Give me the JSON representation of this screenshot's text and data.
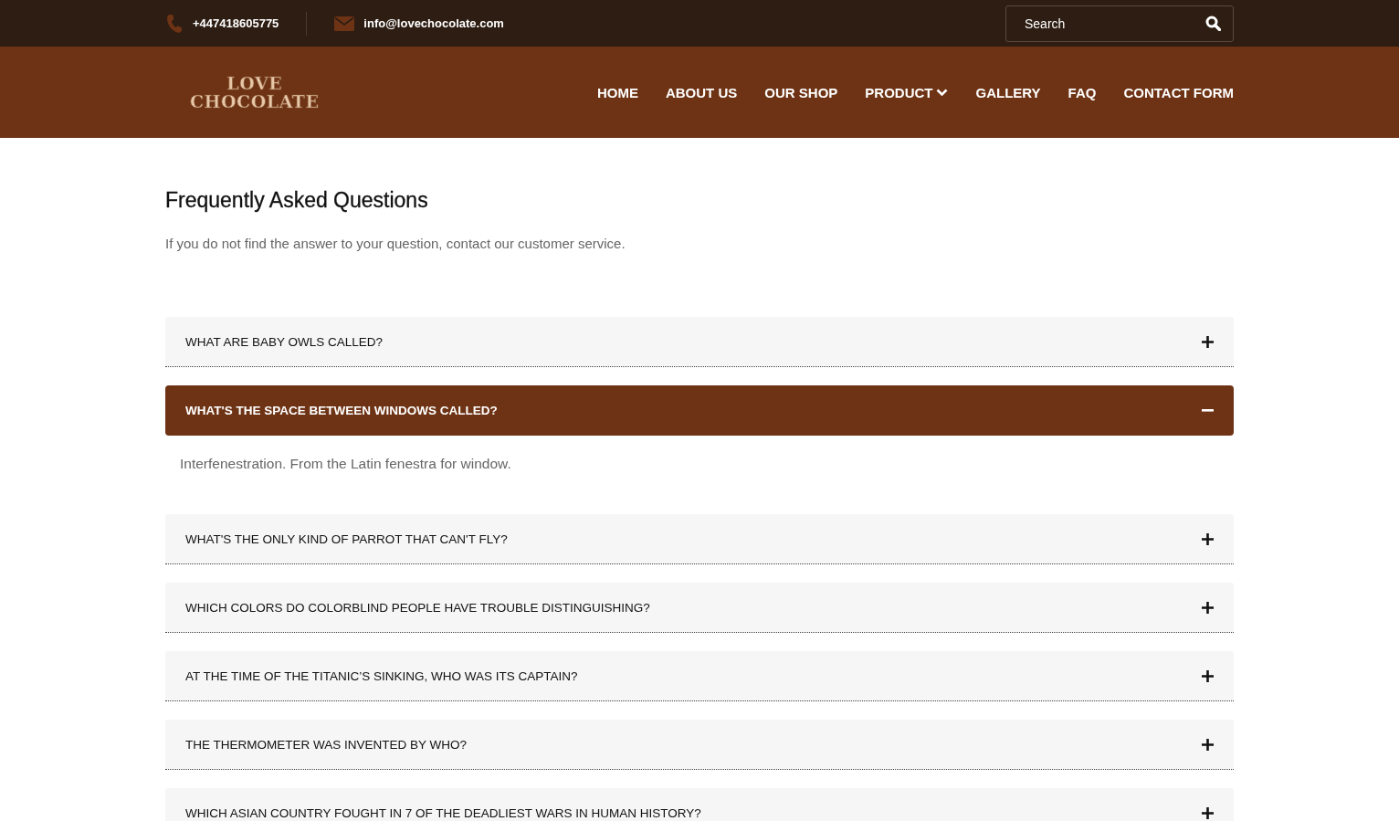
{
  "topbar": {
    "phone": "+447418605775",
    "email": "info@lovechocolate.com",
    "search": {
      "placeholder": "Search"
    }
  },
  "logo": {
    "lines": [
      "LOVE",
      "CHOCOLATE"
    ]
  },
  "nav": [
    {
      "label": "HOME",
      "dropdown": false
    },
    {
      "label": "ABOUT US",
      "dropdown": false
    },
    {
      "label": "OUR SHOP",
      "dropdown": false
    },
    {
      "label": "PRODUCT",
      "dropdown": true
    },
    {
      "label": "GALLERY",
      "dropdown": false
    },
    {
      "label": "FAQ",
      "dropdown": false
    },
    {
      "label": "CONTACT FORM",
      "dropdown": false
    }
  ],
  "heading": "Frequently Asked Questions",
  "intro": "If you do not find the answer to your question, contact our customer service.",
  "faqs": [
    {
      "question": "WHAT ARE BABY OWLS CALLED?",
      "expanded": false
    },
    {
      "question": "WHAT'S THE SPACE BETWEEN WINDOWS CALLED?",
      "expanded": true,
      "answer": "Interfenestration. From the Latin fenestra for window."
    },
    {
      "question": "WHAT'S THE ONLY KIND OF PARROT THAT CAN'T FLY?",
      "expanded": false
    },
    {
      "question": "WHICH COLORS DO COLORBLIND PEOPLE HAVE TROUBLE DISTINGUISHING?",
      "expanded": false
    },
    {
      "question": "AT THE TIME OF THE TITANIC’S SINKING, WHO WAS ITS CAPTAIN?",
      "expanded": false
    },
    {
      "question": "THE THERMOMETER WAS INVENTED BY WHO?",
      "expanded": false
    },
    {
      "question": "WHICH ASIAN COUNTRY FOUGHT IN 7 OF THE DEADLIEST WARS IN HUMAN HISTORY?",
      "expanded": false
    }
  ]
}
